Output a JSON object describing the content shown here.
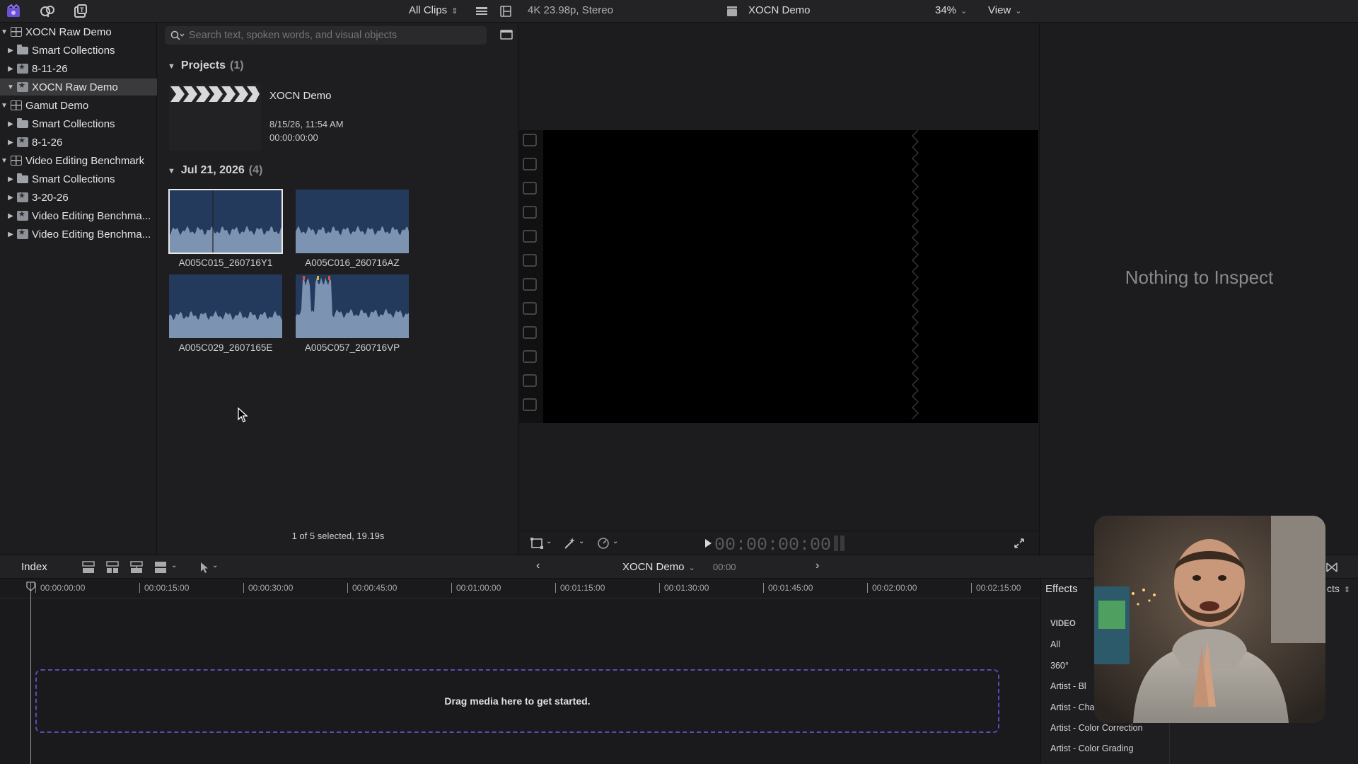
{
  "toolbar": {
    "clip_filter": "All Clips",
    "format": "4K 23.98p, Stereo",
    "project_title": "XOCN Demo",
    "zoom": "34%",
    "view_label": "View"
  },
  "sidebar": {
    "items": [
      {
        "label": "XOCN Raw Demo",
        "icon": "library-icon",
        "level": 0,
        "expanded": true,
        "selected": false
      },
      {
        "label": "Smart Collections",
        "icon": "folder-icon",
        "level": 1,
        "expanded": false,
        "selected": false
      },
      {
        "label": "8-11-26",
        "icon": "event-icon",
        "level": 1,
        "expanded": false,
        "selected": false
      },
      {
        "label": "XOCN Raw Demo",
        "icon": "event-icon",
        "level": 1,
        "expanded": true,
        "selected": true
      },
      {
        "label": "Gamut Demo",
        "icon": "library-icon",
        "level": 0,
        "expanded": true,
        "selected": false
      },
      {
        "label": "Smart Collections",
        "icon": "folder-icon",
        "level": 1,
        "expanded": false,
        "selected": false
      },
      {
        "label": "8-1-26",
        "icon": "event-icon",
        "level": 1,
        "expanded": false,
        "selected": false
      },
      {
        "label": "Video Editing Benchmark",
        "icon": "library-icon",
        "level": 0,
        "expanded": true,
        "selected": false
      },
      {
        "label": "Smart Collections",
        "icon": "folder-icon",
        "level": 1,
        "expanded": false,
        "selected": false
      },
      {
        "label": "3-20-26",
        "icon": "event-icon",
        "level": 1,
        "expanded": false,
        "selected": false
      },
      {
        "label": "Video Editing Benchma...",
        "icon": "event-icon",
        "level": 1,
        "expanded": false,
        "selected": false
      },
      {
        "label": "Video Editing Benchma...",
        "icon": "event-icon",
        "level": 1,
        "expanded": false,
        "selected": false
      }
    ]
  },
  "browser": {
    "search_placeholder": "Search text, spoken words, and visual objects",
    "projects_header": "Projects",
    "projects_count": "(1)",
    "project": {
      "name": "XOCN Demo",
      "date": "8/15/26, 11:54 AM",
      "duration": "00:00:00:00"
    },
    "date_header": "Jul 21, 2026",
    "date_count": "(4)",
    "clips": [
      {
        "name": "A005C015_260716Y1",
        "selected": true
      },
      {
        "name": "A005C016_260716AZ",
        "selected": false
      },
      {
        "name": "A005C029_2607165E",
        "selected": false
      },
      {
        "name": "A005C057_260716VP",
        "selected": false
      }
    ],
    "status": "1 of 5 selected, 19.19s"
  },
  "viewer": {
    "timecode": "00:00:00:00"
  },
  "inspector": {
    "empty_text": "Nothing to Inspect"
  },
  "timeline": {
    "index_label": "Index",
    "project_name": "XOCN Demo",
    "project_time": "00:00",
    "ruler_ticks": [
      "00:00:00:00",
      "00:00:15:00",
      "00:00:30:00",
      "00:00:45:00",
      "00:01:00:00",
      "00:01:15:00",
      "00:01:30:00",
      "00:01:45:00",
      "00:02:00:00",
      "00:02:15:00"
    ],
    "drop_text": "Drag media here to get started."
  },
  "effects": {
    "title": "Effects",
    "categories": [
      "VIDEO",
      "All",
      "360°",
      "Artist - Bl",
      "Artist - Cha",
      "Artist - Color Correction",
      "Artist - Color Grading"
    ],
    "right_partial": "cts"
  },
  "colors": {
    "accent_purple": "#5a4ab8",
    "selection": "#3a3a3c",
    "clip_blue": "#243a5c"
  }
}
